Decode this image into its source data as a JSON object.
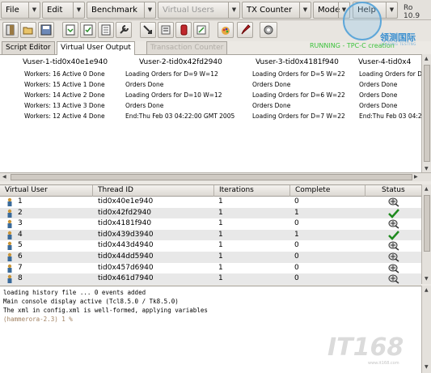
{
  "menubar": {
    "items": [
      {
        "label": "File",
        "disabled": false
      },
      {
        "label": "Edit",
        "disabled": false
      },
      {
        "label": "Benchmark",
        "disabled": false
      },
      {
        "label": "Virtual Users",
        "disabled": true
      },
      {
        "label": "TX Counter",
        "disabled": false
      },
      {
        "label": "Mode",
        "disabled": false
      },
      {
        "label": "Help",
        "disabled": false
      }
    ],
    "version": "Ro 10.9"
  },
  "toolbar": {
    "status_text": "RUNNING - TPC-C creation",
    "status_color": "#3bc23b",
    "icons": [
      "exit-icon",
      "open-icon",
      "save-icon",
      "load-script-icon",
      "build-schema-icon",
      "options-icon",
      "config-icon",
      "create-users-icon",
      "run-icon",
      "stop-icon",
      "counter-icon",
      "options-icon-2",
      "edit-icon",
      "autopilot-icon"
    ]
  },
  "logo": {
    "text": "领测国际",
    "sub": "LEADING TESTING"
  },
  "tabs": [
    {
      "label": "Script Editor",
      "active": false,
      "disabled": false
    },
    {
      "label": "Virtual User Output",
      "active": true,
      "disabled": false
    },
    {
      "label": "Transaction Counter",
      "active": false,
      "disabled": true
    }
  ],
  "output": {
    "columns": [
      {
        "header": "Vuser-1-tid0x40e1e940",
        "lines": [
          "Workers: 16 Active 0 Done",
          "Workers: 15 Active 1 Done",
          "Workers: 14 Active 2 Done",
          "Workers: 13 Active 3 Done",
          "Workers: 12 Active 4 Done"
        ]
      },
      {
        "header": "Vuser-2-tid0x42fd2940",
        "lines": [
          "Loading Orders for D=9 W=12",
          "Orders Done",
          "Loading Orders for D=10 W=12",
          "Orders Done",
          "End:Thu Feb 03 04:22:00 GMT 2005"
        ]
      },
      {
        "header": "Vuser-3-tid0x4181f940",
        "lines": [
          "Loading Orders for D=5 W=22",
          "Orders Done",
          "Loading Orders for D=6 W=22",
          "Orders Done",
          "Loading Orders for D=7 W=22"
        ]
      },
      {
        "header": "Vuser-4-tid0x4",
        "lines": [
          "Loading Orders for D=",
          "Orders Done",
          "Orders Done",
          "Orders Done",
          "End:Thu Feb 03 04:2"
        ]
      }
    ]
  },
  "table": {
    "headers": [
      "Virtual User",
      "Thread ID",
      "Iterations",
      "Complete",
      "Status"
    ],
    "rows": [
      {
        "user": "1",
        "thread": "tid0x40e1e940",
        "iterations": "1",
        "complete": "0",
        "status": "running-icon"
      },
      {
        "user": "2",
        "thread": "tid0x42fd2940",
        "iterations": "1",
        "complete": "1",
        "status": "check-icon"
      },
      {
        "user": "3",
        "thread": "tid0x4181f940",
        "iterations": "1",
        "complete": "0",
        "status": "running-icon"
      },
      {
        "user": "4",
        "thread": "tid0x439d3940",
        "iterations": "1",
        "complete": "1",
        "status": "check-icon"
      },
      {
        "user": "5",
        "thread": "tid0x443d4940",
        "iterations": "1",
        "complete": "0",
        "status": "running-icon"
      },
      {
        "user": "6",
        "thread": "tid0x44dd5940",
        "iterations": "1",
        "complete": "0",
        "status": "running-icon"
      },
      {
        "user": "7",
        "thread": "tid0x457d6940",
        "iterations": "1",
        "complete": "0",
        "status": "running-icon"
      },
      {
        "user": "8",
        "thread": "tid0x461d7940",
        "iterations": "1",
        "complete": "0",
        "status": "running-icon"
      }
    ]
  },
  "console": {
    "lines": [
      "loading history file ... 0 events added",
      "Main console display active (Tcl8.5.0 / Tk8.5.0)",
      "The xml in config.xml is well-formed, applying variables",
      "(hammerora-2.3) 1 %"
    ],
    "text_color": "#2a2aa8"
  },
  "watermark": {
    "text": "IT168",
    "sub": "www.it168.com"
  }
}
